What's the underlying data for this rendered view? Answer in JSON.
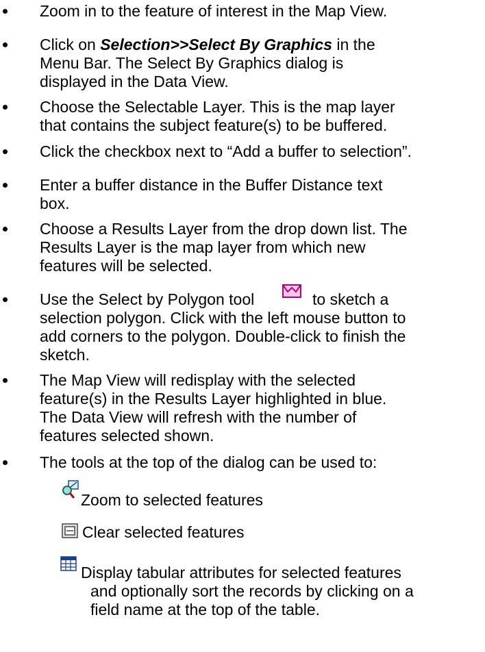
{
  "bullets": [
    {
      "id": "zoom-in",
      "lines": [
        "Zoom in to the feature of interest in the Map View."
      ]
    },
    {
      "id": "click-selection",
      "line1_prefix": "Click on ",
      "line1_emph": "Selection>>Select By Graphics",
      "line1_suffix": " in the",
      "lines_rest": [
        "Menu Bar.  The Select By Graphics dialog is",
        "displayed in the Data View."
      ]
    },
    {
      "id": "choose-layer",
      "lines": [
        "Choose the Selectable Layer.  This is the map layer",
        "that contains the subject feature(s) to be buffered."
      ]
    },
    {
      "id": "click-checkbox",
      "lines": [
        "Click the checkbox next to “Add a buffer to selection”."
      ]
    },
    {
      "id": "enter-buffer",
      "lines": [
        "Enter a buffer distance in the Buffer Distance text",
        "box."
      ]
    },
    {
      "id": "choose-results",
      "lines": [
        "Choose a Results Layer from the drop down list.  The",
        "Results Layer is the map layer from which new",
        "features will be selected."
      ]
    },
    {
      "id": "use-polygon",
      "line1_prefix": "Use the Select by Polygon tool",
      "line1_suffix": "to sketch a",
      "lines_rest": [
        "selection polygon.  Click with the left mouse button to",
        "add corners to the polygon.  Double-click to finish the",
        "sketch."
      ]
    },
    {
      "id": "map-redisplay",
      "lines": [
        "The Map View will redisplay with the selected",
        "feature(s) in the Results Layer highlighted in blue.",
        "The Data View will refresh with the number of",
        "features selected shown."
      ]
    },
    {
      "id": "tools-top",
      "lines": [
        "The tools at the top of the dialog can be used to:"
      ]
    }
  ],
  "tools": [
    {
      "icon": "zoom-to-selected-icon",
      "label_lines": [
        "Zoom to selected features"
      ]
    },
    {
      "icon": "clear-selection-icon",
      "label_lines": [
        "Clear selected features"
      ]
    },
    {
      "icon": "attribute-table-icon",
      "label_lines": [
        "Display tabular attributes for selected features",
        "and optionally sort the records by clicking on a",
        "field name at the top of the table."
      ]
    }
  ]
}
